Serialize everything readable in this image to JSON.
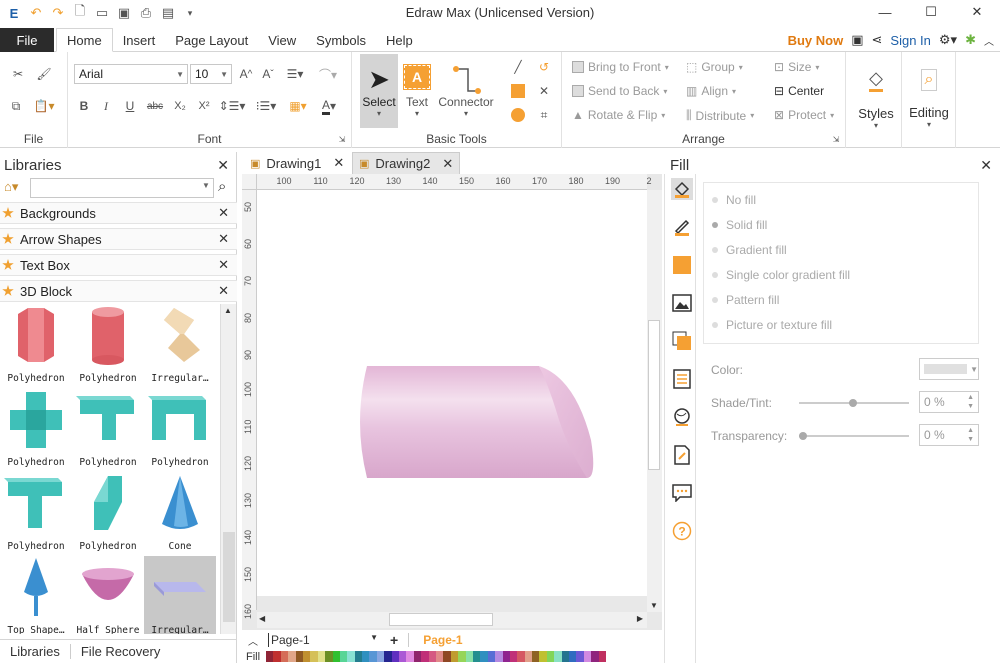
{
  "app": {
    "title": "Edraw Max (Unlicensed Version)"
  },
  "menu": {
    "file": "File",
    "tabs": [
      "Home",
      "Insert",
      "Page Layout",
      "View",
      "Symbols",
      "Help"
    ],
    "active_tab": "Home",
    "buy_now": "Buy Now",
    "sign_in": "Sign In"
  },
  "ribbon": {
    "font_name": "Arial",
    "font_size": "10",
    "groups": {
      "file": "File",
      "font": "Font",
      "basic_tools": "Basic Tools",
      "arrange": "Arrange"
    },
    "select": "Select",
    "text": "Text",
    "connector": "Connector",
    "bold": "B",
    "italic": "I",
    "underline": "U",
    "strike": "abc",
    "sub": "X₂",
    "sup": "X²",
    "arrange": {
      "bring_to_front": "Bring to Front",
      "send_to_back": "Send to Back",
      "rotate_flip": "Rotate & Flip",
      "group": "Group",
      "align": "Align",
      "distribute": "Distribute",
      "size": "Size",
      "center": "Center",
      "protect": "Protect"
    },
    "styles": "Styles",
    "editing": "Editing"
  },
  "libraries": {
    "title": "Libraries",
    "search_placeholder": "",
    "categories": [
      "Backgrounds",
      "Arrow Shapes",
      "Text Box",
      "3D Block"
    ],
    "shapes": [
      {
        "name": "Polyhedron"
      },
      {
        "name": "Polyhedron"
      },
      {
        "name": "Irregular…"
      },
      {
        "name": "Polyhedron"
      },
      {
        "name": "Polyhedron"
      },
      {
        "name": "Polyhedron"
      },
      {
        "name": "Polyhedron"
      },
      {
        "name": "Polyhedron"
      },
      {
        "name": "Cone"
      },
      {
        "name": "Top Shape…"
      },
      {
        "name": "Half Sphere"
      },
      {
        "name": "Irregular…"
      }
    ],
    "bottom_tabs": [
      "Libraries",
      "File Recovery"
    ]
  },
  "documents": {
    "tabs": [
      "Drawing1",
      "Drawing2"
    ],
    "active": "Drawing2"
  },
  "ruler": {
    "h_labels": [
      "100",
      "110",
      "120",
      "130",
      "140",
      "150",
      "160",
      "170",
      "180",
      "190",
      "2"
    ],
    "v_labels": [
      "50",
      "60",
      "70",
      "80",
      "90",
      "100",
      "110",
      "120",
      "130",
      "140",
      "150",
      "160"
    ]
  },
  "pages": {
    "current": "Page-1",
    "tab": "Page-1",
    "fill_label": "Fill"
  },
  "fill_panel": {
    "title": "Fill",
    "options": [
      "No fill",
      "Solid fill",
      "Gradient fill",
      "Single color gradient fill",
      "Pattern fill",
      "Picture or texture fill"
    ],
    "selected": "Solid fill",
    "color_label": "Color:",
    "shade_label": "Shade/Tint:",
    "shade_value": "0 %",
    "transparency_label": "Transparency:",
    "transparency_value": "0 %"
  },
  "colors": {
    "accent_orange": "#f5a033",
    "cylinder_pink": "#e8c4df",
    "red_shape": "#e0626a",
    "teal_shape": "#3fc0b8"
  }
}
